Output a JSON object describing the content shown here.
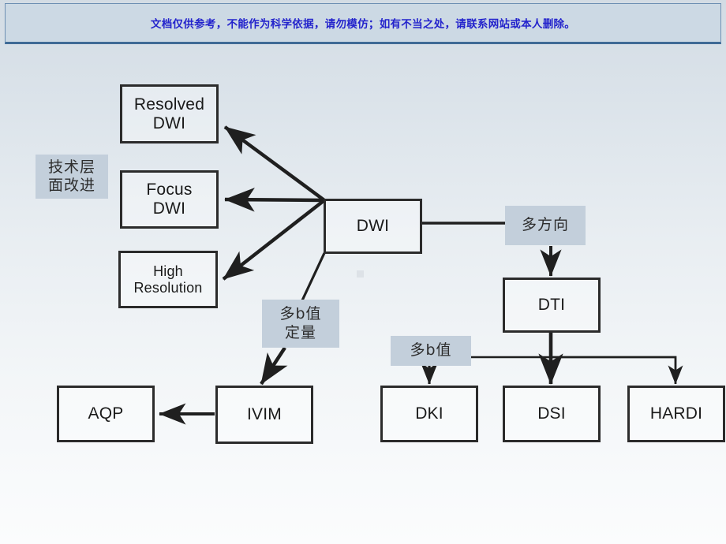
{
  "banner": {
    "text": "文档仅供参考，不能作为科学依据，请勿模仿；如有不当之处，请联系网站或本人删除。",
    "text_color": "#2323cc",
    "background_color": "#ccd9e4",
    "border_color": "#3f6b96"
  },
  "theme": {
    "node_border_color": "#2b2b2b",
    "annotation_background": "#c3cfdb",
    "background_top": "#d3dce4",
    "background_bottom": "#fbfcfd"
  },
  "diagram": {
    "type": "flowchart",
    "nodes": [
      {
        "id": "resolved-dwi",
        "label": "Resolved\nDWI",
        "line1": "Resolved",
        "line2": "DWI"
      },
      {
        "id": "focus-dwi",
        "label": "Focus\nDWI",
        "line1": "Focus",
        "line2": "DWI"
      },
      {
        "id": "high-resolution",
        "label": "High\nResolution",
        "line1": "High",
        "line2": "Resolution"
      },
      {
        "id": "dwi",
        "label": "DWI"
      },
      {
        "id": "dti",
        "label": "DTI"
      },
      {
        "id": "ivim",
        "label": "IVIM"
      },
      {
        "id": "aqp",
        "label": "AQP"
      },
      {
        "id": "dki",
        "label": "DKI"
      },
      {
        "id": "dsi",
        "label": "DSI"
      },
      {
        "id": "hardi",
        "label": "HARDI"
      }
    ],
    "annotations": [
      {
        "id": "tech-improvement",
        "line1": "技术层",
        "line2": "面改进"
      },
      {
        "id": "multi-direction",
        "line1": "多方向"
      },
      {
        "id": "multi-b-quant",
        "line1": "多b值",
        "line2": "定量"
      },
      {
        "id": "multi-b",
        "line1": "多b值"
      }
    ],
    "edges": [
      {
        "from": "dwi",
        "to": "resolved-dwi",
        "arrow": true
      },
      {
        "from": "dwi",
        "to": "focus-dwi",
        "arrow": true
      },
      {
        "from": "dwi",
        "to": "high-resolution",
        "arrow": true
      },
      {
        "from": "dwi",
        "to": "multi-b-quant",
        "arrow": false
      },
      {
        "from": "multi-b-quant",
        "to": "ivim",
        "arrow": true
      },
      {
        "from": "ivim",
        "to": "aqp",
        "arrow": true
      },
      {
        "from": "dwi",
        "to": "multi-direction",
        "arrow": false
      },
      {
        "from": "multi-direction",
        "to": "dti",
        "arrow": true
      },
      {
        "from": "dti",
        "to": "dsi",
        "arrow": true
      },
      {
        "from": "dti",
        "to": "multi-b",
        "arrow": false
      },
      {
        "from": "multi-b",
        "to": "dki",
        "arrow": true
      },
      {
        "from": "dti",
        "to": "hardi",
        "arrow": true
      }
    ]
  }
}
